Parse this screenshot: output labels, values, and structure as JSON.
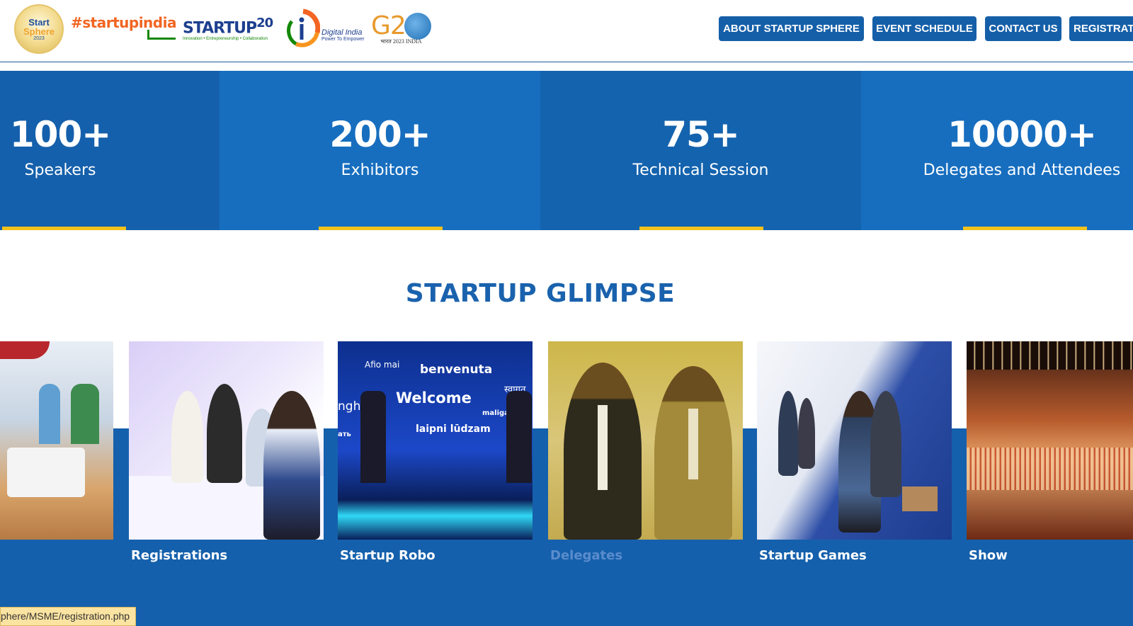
{
  "header": {
    "logos": {
      "sphere": {
        "line1": "Start",
        "line2": "Sphere",
        "line3": "2023"
      },
      "startupindia": "#startupindia",
      "startup20": {
        "main": "STARTUP",
        "sup": "20",
        "tagline": "Innovation • Entrepreneurship • Collaboration"
      },
      "digital_india": {
        "line1": "Digital India",
        "line2": "Power To Empower"
      },
      "g20": {
        "main": "G2",
        "tagline": "भारत 2023 INDIA"
      }
    },
    "nav": [
      {
        "label": "ABOUT STARTUP SPHERE"
      },
      {
        "label": "EVENT SCHEDULE"
      },
      {
        "label": "CONTACT US"
      },
      {
        "label": "REGISTRATI"
      }
    ]
  },
  "stats": [
    {
      "value": "100+",
      "label": "Speakers"
    },
    {
      "value": "200+",
      "label": "Exhibitors"
    },
    {
      "value": "75+",
      "label": "Technical Session"
    },
    {
      "value": "10000+",
      "label": "Delegates and Attendees"
    }
  ],
  "glimpse": {
    "title": "STARTUP GLIMPSE",
    "cards": [
      {
        "caption": ""
      },
      {
        "caption": "Registrations"
      },
      {
        "caption": "Startup Robo",
        "screen_words": [
          "Afio mai",
          "benvenuta",
          "Welcome",
          "स्वागत",
          "nghe",
          "maligay",
          "ать",
          "laipni lūdzam"
        ]
      },
      {
        "caption": "Delegates"
      },
      {
        "caption": "Startup Games"
      },
      {
        "caption": "Show"
      }
    ]
  },
  "status_bar": {
    "url": "phere/MSME/registration.php"
  },
  "colors": {
    "primary_blue": "#1560ac",
    "accent_yellow": "#f3c21b",
    "title_blue": "#1a62ad"
  }
}
